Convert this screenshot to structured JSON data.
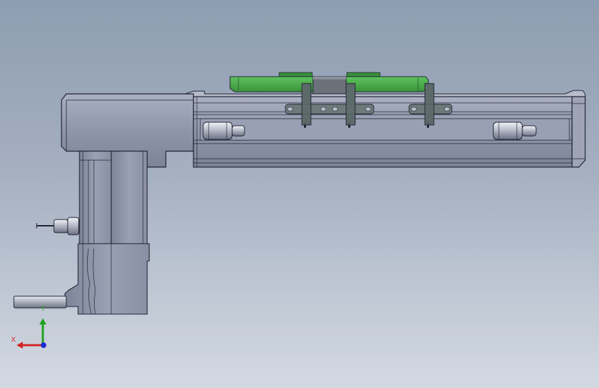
{
  "viewport": {
    "background_top": "#8e9db1",
    "background_bottom": "#d3d9e2"
  },
  "model": {
    "body_color": "#8d93a8",
    "edge_color": "#1f2230",
    "carriage_color": "#4aa84a",
    "bracket_color": "#5d6a6a"
  },
  "triad": {
    "x_label": "X",
    "y_label": "Y",
    "x_color": "#d42424",
    "y_color": "#1da01d",
    "z_color": "#1e2cd4"
  }
}
